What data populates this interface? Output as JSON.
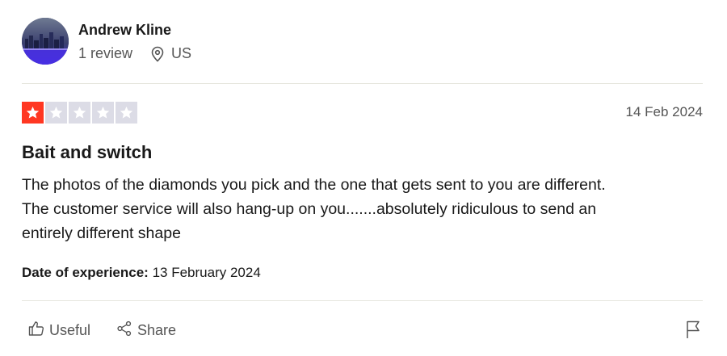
{
  "reviewer": {
    "name": "Andrew Kline",
    "review_count": "1 review",
    "country": "US"
  },
  "review": {
    "rating": 1,
    "max_rating": 5,
    "date": "14 Feb 2024",
    "title": "Bait and switch",
    "body_lines": [
      "The photos of the diamonds you pick and the one that gets sent to you are different.",
      "The customer service will also hang-up on you.......absolutely ridiculous to send an",
      "entirely different shape"
    ],
    "experience_label": "Date of experience:",
    "experience_date": "13 February 2024"
  },
  "actions": {
    "useful_label": "Useful",
    "share_label": "Share"
  },
  "icons": {
    "location": "location-pin-icon",
    "useful": "thumbs-up-icon",
    "share": "share-icon",
    "report": "flag-icon"
  },
  "colors": {
    "star_active": "#ff3722",
    "star_inactive": "#dcdce6",
    "text_muted": "#555555",
    "text_primary": "#191919"
  }
}
